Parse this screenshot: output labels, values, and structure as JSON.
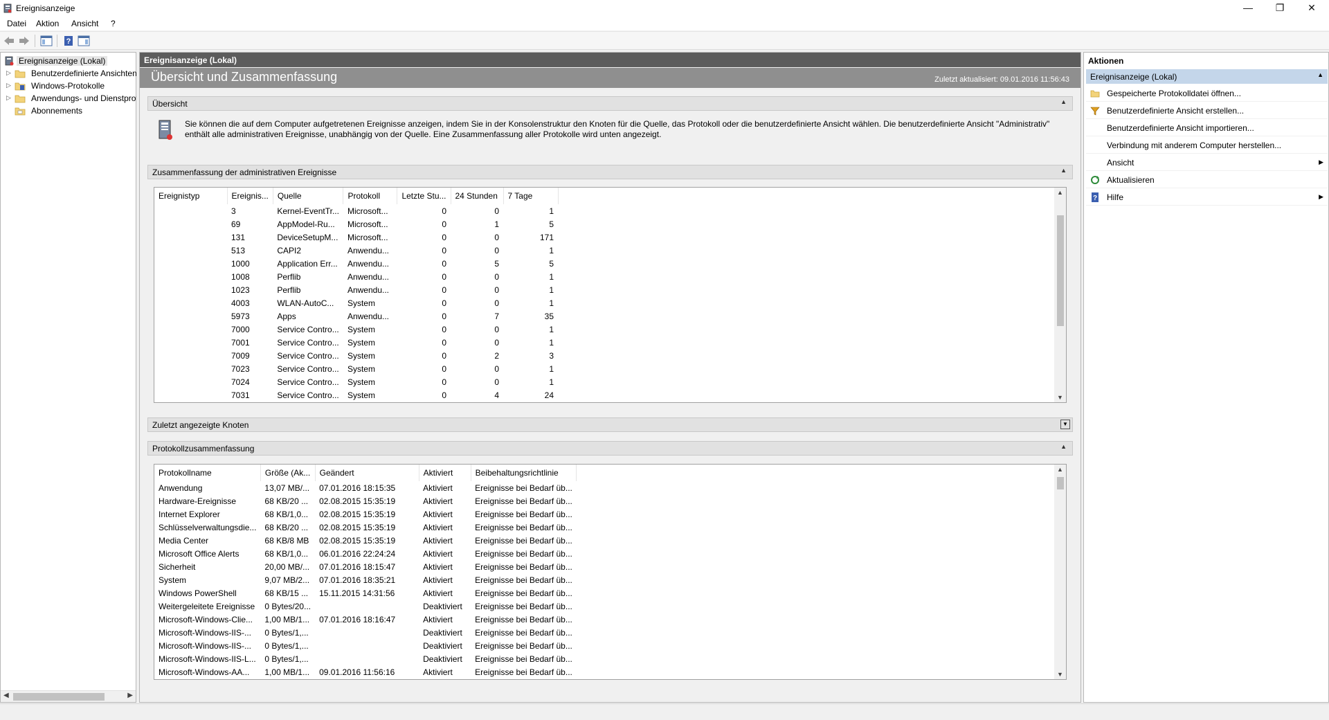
{
  "window": {
    "title": "Ereignisanzeige",
    "controls": {
      "minimize": "—",
      "restore": "❐",
      "close": "✕"
    }
  },
  "menu": [
    "Datei",
    "Aktion",
    "Ansicht",
    "?"
  ],
  "toolbar": {
    "icons": [
      "back-arrow-icon",
      "forward-arrow-icon",
      "show-hide-tree-icon",
      "help-icon",
      "show-hide-action-pane-icon"
    ]
  },
  "tree": {
    "root": "Ereignisanzeige (Lokal)",
    "items": [
      {
        "label": "Benutzerdefinierte Ansichten",
        "icon": "folder-icon"
      },
      {
        "label": "Windows-Protokolle",
        "icon": "folder-log-icon"
      },
      {
        "label": "Anwendungs- und Dienstprotokolle",
        "icon": "folder-icon"
      },
      {
        "label": "Abonnements",
        "icon": "subscription-icon"
      }
    ]
  },
  "center": {
    "header": "Ereignisanzeige (Lokal)",
    "banner_title": "Übersicht und Zusammenfassung",
    "last_updated": "Zuletzt aktualisiert: 09.01.2016 11:56:43",
    "overview": {
      "title": "Übersicht",
      "text": "Sie können die auf dem Computer aufgetretenen Ereignisse anzeigen, indem Sie in der Konsolenstruktur den Knoten für die Quelle, das Protokoll oder die benutzerdefinierte Ansicht wählen. Die benutzerdefinierte Ansicht \"Administrativ\" enthält alle administrativen Ereignisse, unabhängig von der Quelle. Eine Zusammenfassung aller Protokolle wird unten angezeigt."
    },
    "admin_summary": {
      "title": "Zusammenfassung der administrativen Ereignisse",
      "columns": [
        "Ereignistyp",
        "Ereignis...",
        "Quelle",
        "Protokoll",
        "Letzte Stu...",
        "24 Stunden",
        "7 Tage"
      ],
      "rows": [
        [
          "",
          "3",
          "Kernel-EventTr...",
          "Microsoft...",
          "0",
          "0",
          "1"
        ],
        [
          "",
          "69",
          "AppModel-Ru...",
          "Microsoft...",
          "0",
          "1",
          "5"
        ],
        [
          "",
          "131",
          "DeviceSetupM...",
          "Microsoft...",
          "0",
          "0",
          "171"
        ],
        [
          "",
          "513",
          "CAPI2",
          "Anwendu...",
          "0",
          "0",
          "1"
        ],
        [
          "",
          "1000",
          "Application Err...",
          "Anwendu...",
          "0",
          "5",
          "5"
        ],
        [
          "",
          "1008",
          "Perflib",
          "Anwendu...",
          "0",
          "0",
          "1"
        ],
        [
          "",
          "1023",
          "Perflib",
          "Anwendu...",
          "0",
          "0",
          "1"
        ],
        [
          "",
          "4003",
          "WLAN-AutoC...",
          "System",
          "0",
          "0",
          "1"
        ],
        [
          "",
          "5973",
          "Apps",
          "Anwendu...",
          "0",
          "7",
          "35"
        ],
        [
          "",
          "7000",
          "Service Contro...",
          "System",
          "0",
          "0",
          "1"
        ],
        [
          "",
          "7001",
          "Service Contro...",
          "System",
          "0",
          "0",
          "1"
        ],
        [
          "",
          "7009",
          "Service Contro...",
          "System",
          "0",
          "2",
          "3"
        ],
        [
          "",
          "7023",
          "Service Contro...",
          "System",
          "0",
          "0",
          "1"
        ],
        [
          "",
          "7024",
          "Service Contro...",
          "System",
          "0",
          "0",
          "1"
        ],
        [
          "",
          "7031",
          "Service Contro...",
          "System",
          "0",
          "4",
          "24"
        ]
      ]
    },
    "recent_nodes": {
      "title": "Zuletzt angezeigte Knoten"
    },
    "log_summary": {
      "title": "Protokollzusammenfassung",
      "columns": [
        "Protokollname",
        "Größe (Ak...",
        "Geändert",
        "Aktiviert",
        "Beibehaltungsrichtlinie"
      ],
      "rows": [
        [
          "Anwendung",
          "13,07 MB/...",
          "07.01.2016 18:15:35",
          "Aktiviert",
          "Ereignisse bei Bedarf üb..."
        ],
        [
          "Hardware-Ereignisse",
          "68 KB/20 ...",
          "02.08.2015 15:35:19",
          "Aktiviert",
          "Ereignisse bei Bedarf üb..."
        ],
        [
          "Internet Explorer",
          "68 KB/1,0...",
          "02.08.2015 15:35:19",
          "Aktiviert",
          "Ereignisse bei Bedarf üb..."
        ],
        [
          "Schlüsselverwaltungsdie...",
          "68 KB/20 ...",
          "02.08.2015 15:35:19",
          "Aktiviert",
          "Ereignisse bei Bedarf üb..."
        ],
        [
          "Media Center",
          "68 KB/8 MB",
          "02.08.2015 15:35:19",
          "Aktiviert",
          "Ereignisse bei Bedarf üb..."
        ],
        [
          "Microsoft Office Alerts",
          "68 KB/1,0...",
          "06.01.2016 22:24:24",
          "Aktiviert",
          "Ereignisse bei Bedarf üb..."
        ],
        [
          "Sicherheit",
          "20,00 MB/...",
          "07.01.2016 18:15:47",
          "Aktiviert",
          "Ereignisse bei Bedarf üb..."
        ],
        [
          "System",
          "9,07 MB/2...",
          "07.01.2016 18:35:21",
          "Aktiviert",
          "Ereignisse bei Bedarf üb..."
        ],
        [
          "Windows PowerShell",
          "68 KB/15 ...",
          "15.11.2015 14:31:56",
          "Aktiviert",
          "Ereignisse bei Bedarf üb..."
        ],
        [
          "Weitergeleitete Ereignisse",
          "0 Bytes/20...",
          "",
          "Deaktiviert",
          "Ereignisse bei Bedarf üb..."
        ],
        [
          "Microsoft-Windows-Clie...",
          "1,00 MB/1...",
          "07.01.2016 18:16:47",
          "Aktiviert",
          "Ereignisse bei Bedarf üb..."
        ],
        [
          "Microsoft-Windows-IIS-...",
          "0 Bytes/1,...",
          "",
          "Deaktiviert",
          "Ereignisse bei Bedarf üb..."
        ],
        [
          "Microsoft-Windows-IIS-...",
          "0 Bytes/1,...",
          "",
          "Deaktiviert",
          "Ereignisse bei Bedarf üb..."
        ],
        [
          "Microsoft-Windows-IIS-L...",
          "0 Bytes/1,...",
          "",
          "Deaktiviert",
          "Ereignisse bei Bedarf üb..."
        ],
        [
          "Microsoft-Windows-AA...",
          "1,00 MB/1...",
          "09.01.2016 11:56:16",
          "Aktiviert",
          "Ereignisse bei Bedarf üb..."
        ]
      ]
    }
  },
  "actions": {
    "title": "Aktionen",
    "group": "Ereignisanzeige (Lokal)",
    "items": [
      {
        "label": "Gespeicherte Protokolldatei öffnen...",
        "icon": "open-log-icon",
        "submenu": false
      },
      {
        "label": "Benutzerdefinierte Ansicht erstellen...",
        "icon": "filter-icon",
        "submenu": false
      },
      {
        "label": "Benutzerdefinierte Ansicht importieren...",
        "icon": "",
        "submenu": false
      },
      {
        "label": "Verbindung mit anderem Computer herstellen...",
        "icon": "",
        "submenu": false
      },
      {
        "label": "Ansicht",
        "icon": "",
        "submenu": true
      },
      {
        "label": "Aktualisieren",
        "icon": "refresh-icon",
        "submenu": false
      },
      {
        "label": "Hilfe",
        "icon": "help-icon",
        "submenu": true
      }
    ]
  }
}
